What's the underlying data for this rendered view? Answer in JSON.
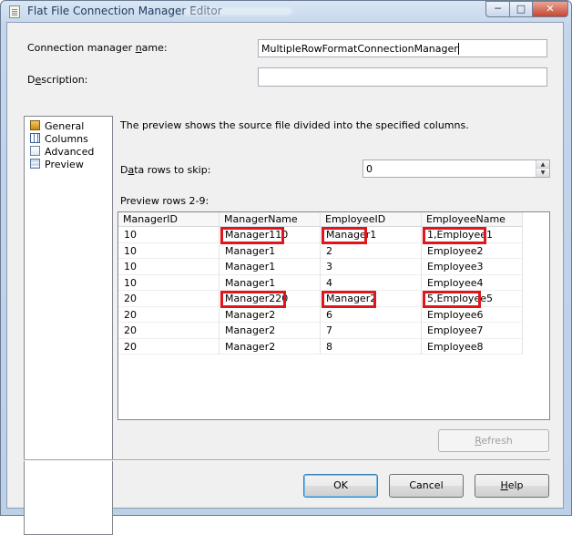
{
  "window": {
    "title": "Flat File Connection Manager Editor"
  },
  "form": {
    "name_label_pre": "Connection manager ",
    "name_label_key": "n",
    "name_label_post": "ame:",
    "name_value": "MultipleRowFormatConnectionManager",
    "desc_label_pre": "D",
    "desc_label_key": "e",
    "desc_label_post": "scription:",
    "desc_value": ""
  },
  "nav": {
    "items": [
      {
        "label": "General",
        "icon": "general-icon"
      },
      {
        "label": "Columns",
        "icon": "columns-icon"
      },
      {
        "label": "Advanced",
        "icon": "advanced-icon"
      },
      {
        "label": "Preview",
        "icon": "preview-icon"
      }
    ],
    "selected": "Preview"
  },
  "preview": {
    "description": "The preview shows the source file divided into the specified columns.",
    "skip_label_pre": "D",
    "skip_label_key": "a",
    "skip_label_post": "ta rows to skip:",
    "skip_value": "0",
    "rows_label": "Preview rows 2-9:",
    "columns": [
      "ManagerID",
      "ManagerName",
      "EmployeeID",
      "EmployeeName"
    ],
    "rows": [
      [
        "10",
        "Manager110",
        "Manager1",
        "1,Employee1"
      ],
      [
        "10",
        "Manager1",
        "2",
        "Employee2"
      ],
      [
        "10",
        "Manager1",
        "3",
        "Employee3"
      ],
      [
        "10",
        "Manager1",
        "4",
        "Employee4"
      ],
      [
        "20",
        "Manager220",
        "Manager2",
        "5,Employee5"
      ],
      [
        "20",
        "Manager2",
        "6",
        "Employee6"
      ],
      [
        "20",
        "Manager2",
        "7",
        "Employee7"
      ],
      [
        "20",
        "Manager2",
        "8",
        "Employee8"
      ]
    ]
  },
  "buttons": {
    "refresh_pre": "",
    "refresh_key": "R",
    "refresh_post": "efresh",
    "ok": "OK",
    "cancel": "Cancel",
    "help_pre": "",
    "help_key": "H",
    "help_post": "elp"
  },
  "colors": {
    "highlight": "#e0161c"
  }
}
